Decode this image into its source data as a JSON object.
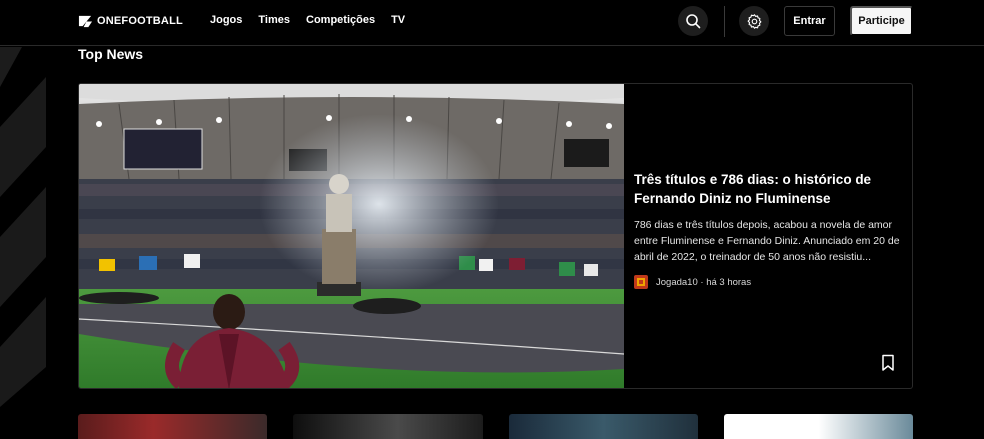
{
  "header": {
    "logo_text": "ONEFOOTBALL",
    "nav": [
      "Jogos",
      "Times",
      "Competições",
      "TV"
    ],
    "login_label": "Entrar",
    "signup_label": "Participe"
  },
  "section_title": "Top News",
  "featured": {
    "headline": "Três títulos e 786 dias: o histórico de Fernando Diniz no Fluminense",
    "excerpt": "786 dias e três títulos depois, acabou a novela de amor entre Fluminense e Fernando Diniz. Anunciado em 20 de abril de 2022, o treinador de 50 anos não resistiu...",
    "source": "Jogada10",
    "time": "há 3 horas"
  },
  "colors": {
    "background": "#000000",
    "card_border": "#2a2a2a",
    "signup_bg": "#f6f6f6",
    "source_logo": "#c0391b"
  }
}
